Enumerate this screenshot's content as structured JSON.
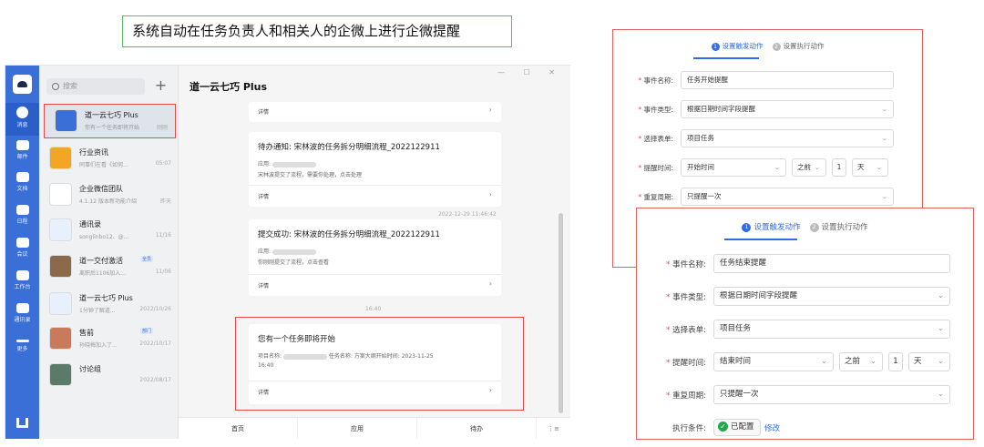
{
  "caption": "系统自动在任务负责人和相关人的企微上进行企微提醒",
  "wecom": {
    "rail": [
      "消息",
      "邮件",
      "文档",
      "日程",
      "会议",
      "工作台",
      "通讯录",
      "更多"
    ],
    "search_placeholder": "搜索",
    "plus": "+",
    "conversations": [
      {
        "name": "道一云七巧 Plus",
        "preview": "你有一个任务即将开始",
        "time": "刚刚",
        "color": "#3a6fd8"
      },
      {
        "name": "行业资讯",
        "preview": "同事们在看《如何...",
        "time": "05:07",
        "color": "#f2a623"
      },
      {
        "name": "企业微信团队",
        "preview": "4.1.12 版本新功能介绍",
        "time": "昨天",
        "color": "#ffffff"
      },
      {
        "name": "通讯录",
        "preview": "songlinbo12、@...",
        "time": "11/16",
        "color": "#e8f0fe"
      },
      {
        "name": "道一交付激活",
        "preview": "离职后1106加入...",
        "time": "11/06",
        "tag": "全员",
        "color": "#8a6a4a"
      },
      {
        "name": "道一云七巧 Plus",
        "preview": "1分钟了解道...",
        "time": "2022/10/26",
        "color": "#e8f0fe"
      },
      {
        "name": "售前",
        "preview": "孙晓梅加入了...",
        "time": "2022/10/17",
        "tag": "部门",
        "color": "#c97a5a"
      },
      {
        "name": "讨论组",
        "preview": "",
        "time": "2022/08/17",
        "color": "#5a7a6a"
      }
    ],
    "chat_title": "道一云七巧 Plus",
    "window_controls": "— ☐ ✕",
    "detail": "详情",
    "card2": {
      "title": "待办通知: 宋林波的任务拆分明细流程_2022122911",
      "app": "应用:",
      "desc": "宋林波提交了流程，需要你处理，点击处理"
    },
    "stamp1": "2022-12-29 11:46:42",
    "card3": {
      "title": "提交成功: 宋林波的任务拆分明细流程_2022122911",
      "app": "应用:",
      "desc": "你刚刚提交了流程，点击查看"
    },
    "stamp2": "16:40",
    "card4": {
      "title": "您有一个任务即将开始",
      "meta_a": "项目名称:",
      "meta_b": "任务名称: 方案大纲开始时间: 2023-11-25",
      "meta_c": "16:40"
    },
    "bottom_tabs": [
      "首页",
      "应用",
      "待办"
    ],
    "bottom_more": "⋮≡"
  },
  "form_back": {
    "step1": "设置触发动作",
    "step2": "设置执行动作",
    "rows": [
      {
        "label": "事件名称:",
        "value": "任务开始提醒"
      },
      {
        "label": "事件类型:",
        "value": "根据日期时间字段提醒"
      },
      {
        "label": "选择表单:",
        "value": "项目任务"
      },
      {
        "label": "提醒时间:",
        "value": "开始时间",
        "dir": "之前",
        "n": "1",
        "unit": "天"
      },
      {
        "label": "重复周期:",
        "value": "只提醒一次"
      }
    ]
  },
  "form_front": {
    "step1": "设置触发动作",
    "step2": "设置执行动作",
    "rows": [
      {
        "label": "事件名称:",
        "value": "任务结束提醒"
      },
      {
        "label": "事件类型:",
        "value": "根据日期时间字段提醒"
      },
      {
        "label": "选择表单:",
        "value": "项目任务"
      },
      {
        "label": "提醒时间:",
        "value": "结束时间",
        "dir": "之前",
        "n": "1",
        "unit": "天"
      },
      {
        "label": "重复周期:",
        "value": "只提醒一次"
      }
    ],
    "exec_label": "执行条件:",
    "configured": "已配置",
    "edit": "修改"
  }
}
